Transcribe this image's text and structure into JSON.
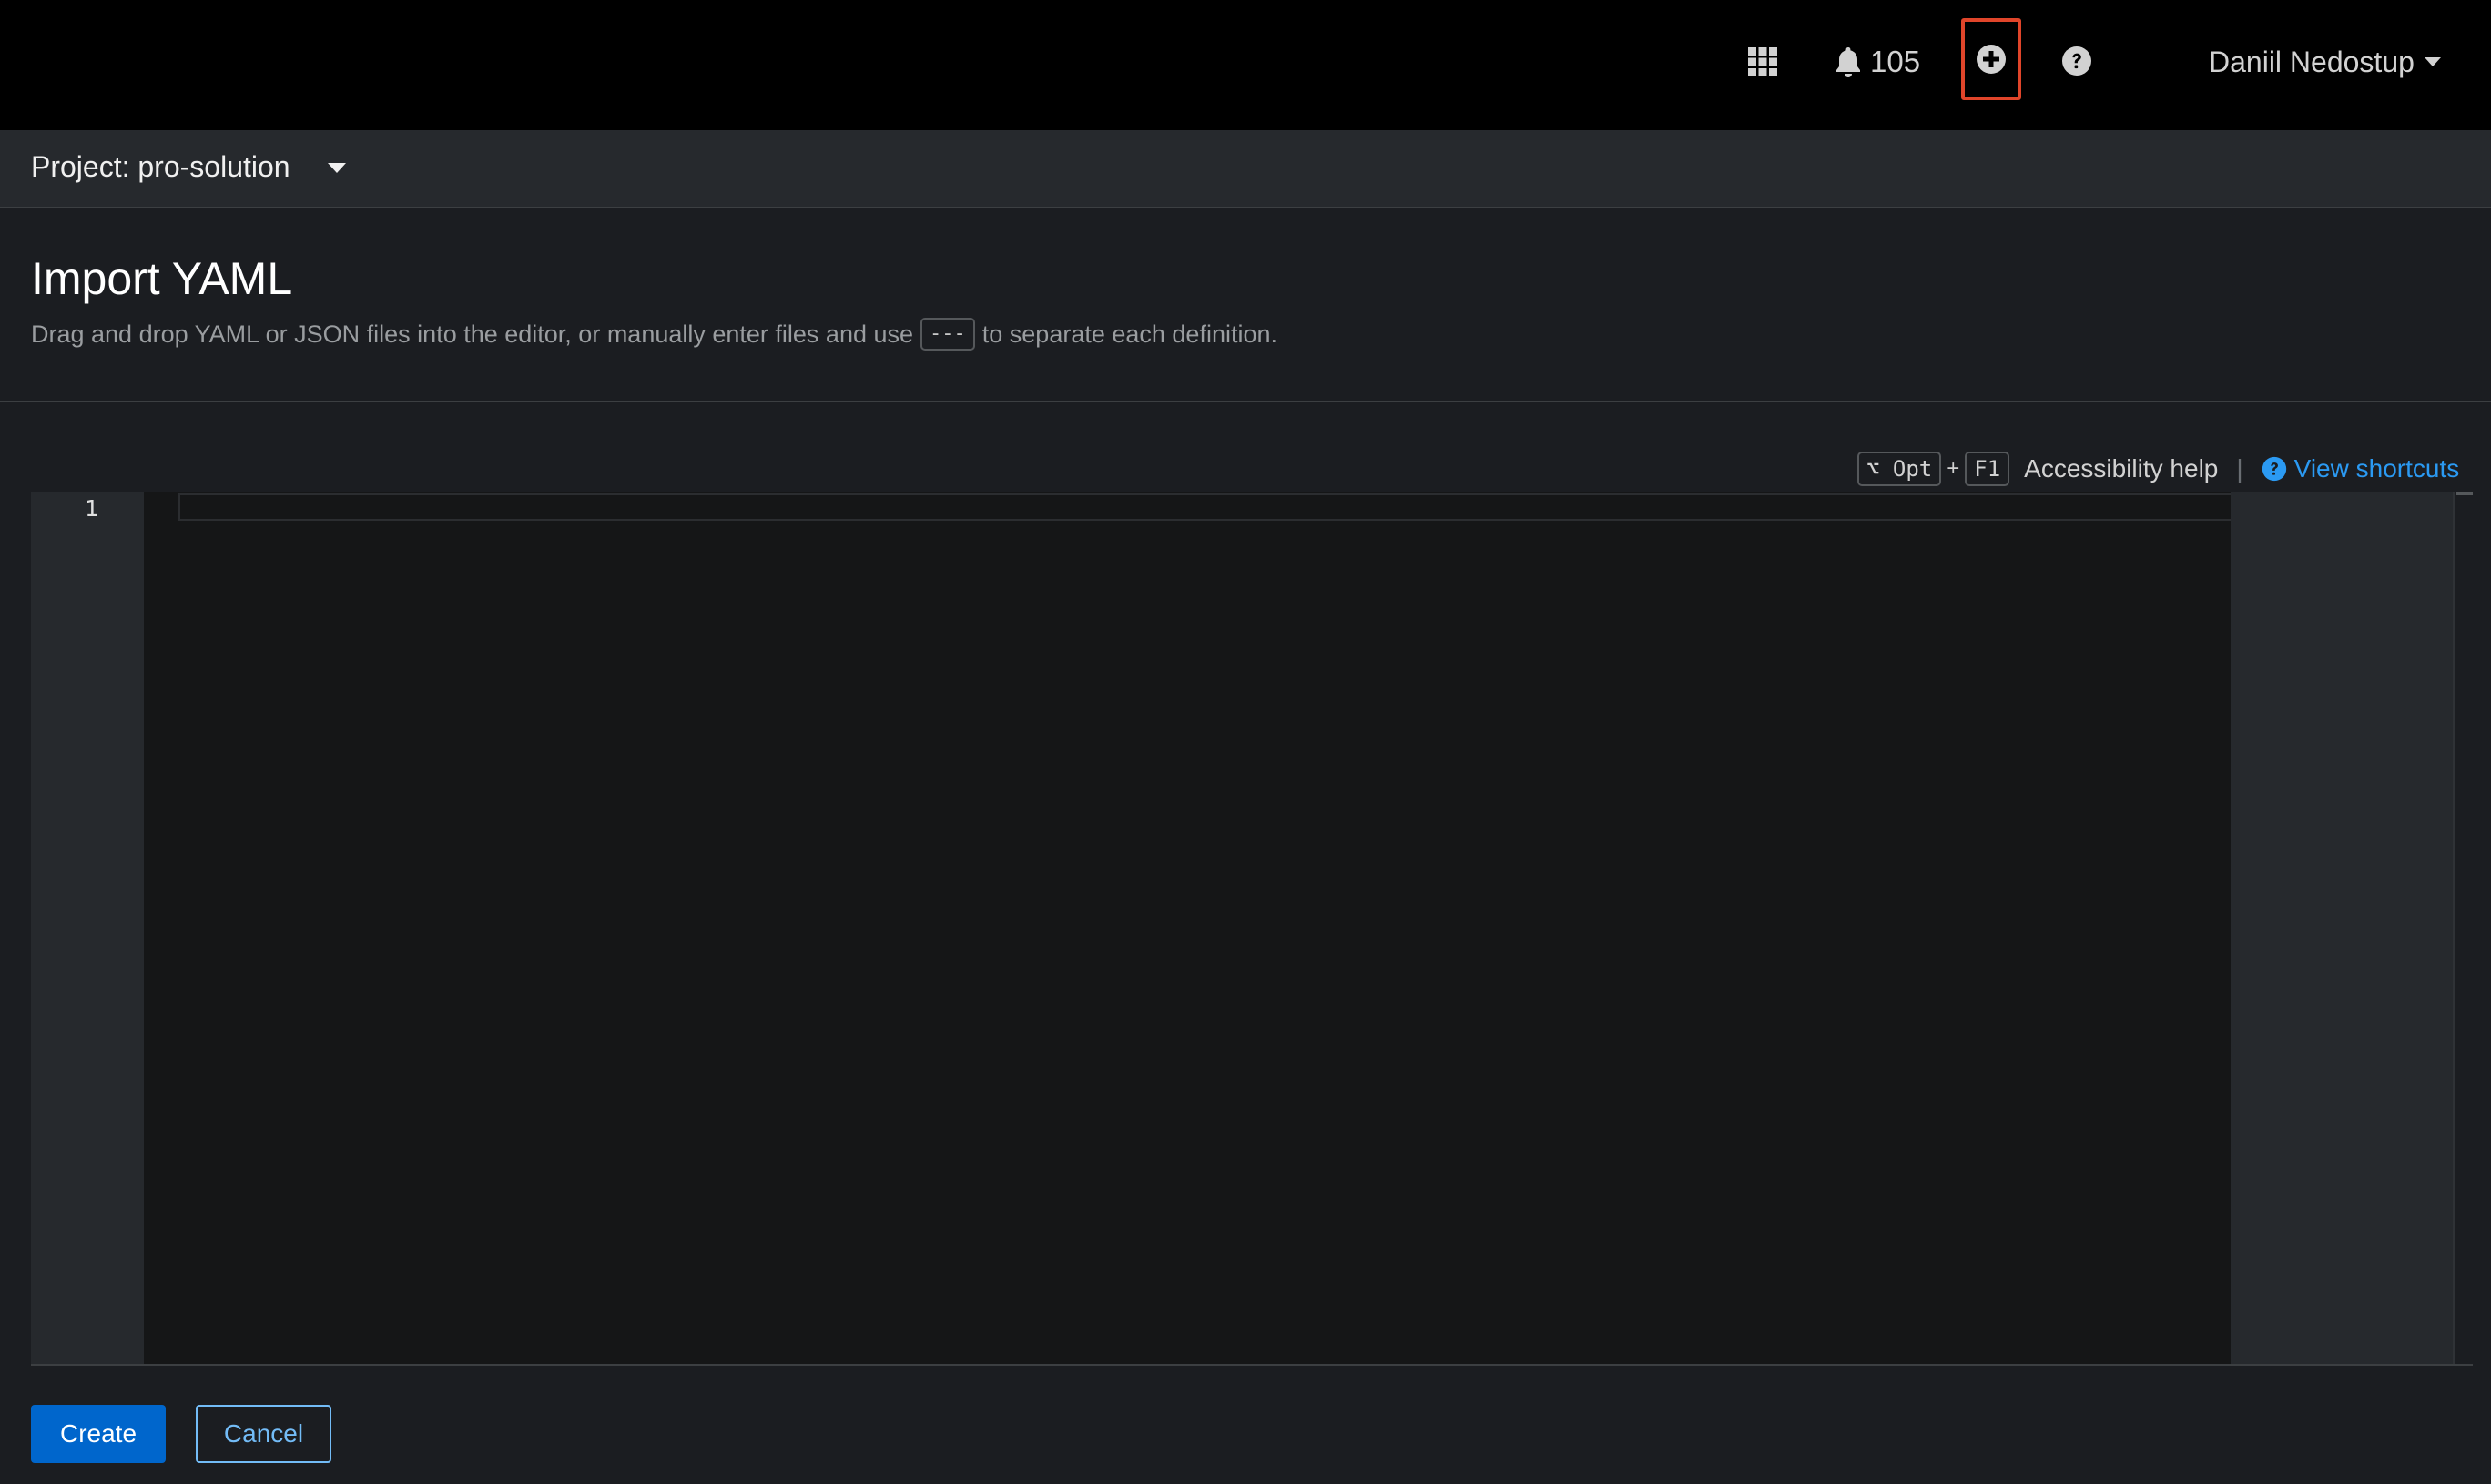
{
  "masthead": {
    "apps_icon": "grid-icon",
    "notifications": {
      "icon": "bell-icon",
      "count": "105"
    },
    "quick_create_icon": "plus-circle-icon",
    "help_icon": "question-circle-icon",
    "user_name": "Daniil Nedostup",
    "highlight_color": "#e0452a"
  },
  "project_bar": {
    "label": "Project: pro-solution"
  },
  "page": {
    "title": "Import YAML",
    "description_before": "Drag and drop YAML or JSON files into the editor, or manually enter files and use",
    "separator_code": "---",
    "description_after": "to separate each definition."
  },
  "editor_toolbar": {
    "key_modifier": "⌥ Opt",
    "key_plus": "+",
    "key_f1": "F1",
    "accessibility_label": "Accessibility help",
    "divider": "|",
    "view_shortcuts_label": "View shortcuts"
  },
  "editor": {
    "line_numbers": [
      "1"
    ],
    "content": ""
  },
  "actions": {
    "create_label": "Create",
    "cancel_label": "Cancel",
    "primary_color": "#0066cc",
    "link_color": "#73bcf7"
  }
}
